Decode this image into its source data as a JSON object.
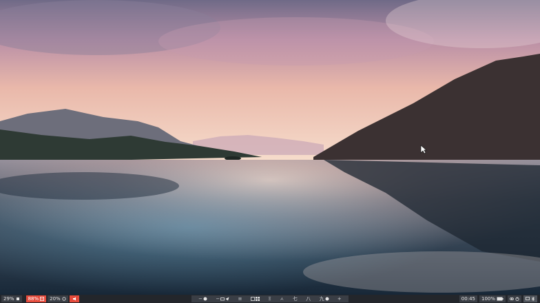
{
  "wallpaper": {
    "sky_top": "#7d7592",
    "sky_mid": "#d9a9a6",
    "sky_horizon": "#f3d6c4",
    "water_light": "#e9cbc2",
    "water_dark": "#1f3243"
  },
  "taskbar": {
    "left": {
      "brightness": "29%",
      "cpu": "88%",
      "volume": "20%"
    },
    "center": {
      "workspaces": [
        {
          "label": "−",
          "icon": "clock-icon"
        },
        {
          "label": "−",
          "icon": "folder-icon"
        },
        {
          "label": "≡",
          "icon": "menu-icon"
        },
        {
          "label": "Ξ",
          "icon": "grid-icon"
        },
        {
          "label": "ㅅ",
          "icon": ""
        },
        {
          "label": "七",
          "icon": ""
        },
        {
          "label": "八",
          "icon": ""
        },
        {
          "label": "九",
          "icon": "clock-icon"
        },
        {
          "label": "+",
          "icon": ""
        }
      ]
    },
    "right": {
      "time": "00:45",
      "battery": "100%"
    }
  }
}
